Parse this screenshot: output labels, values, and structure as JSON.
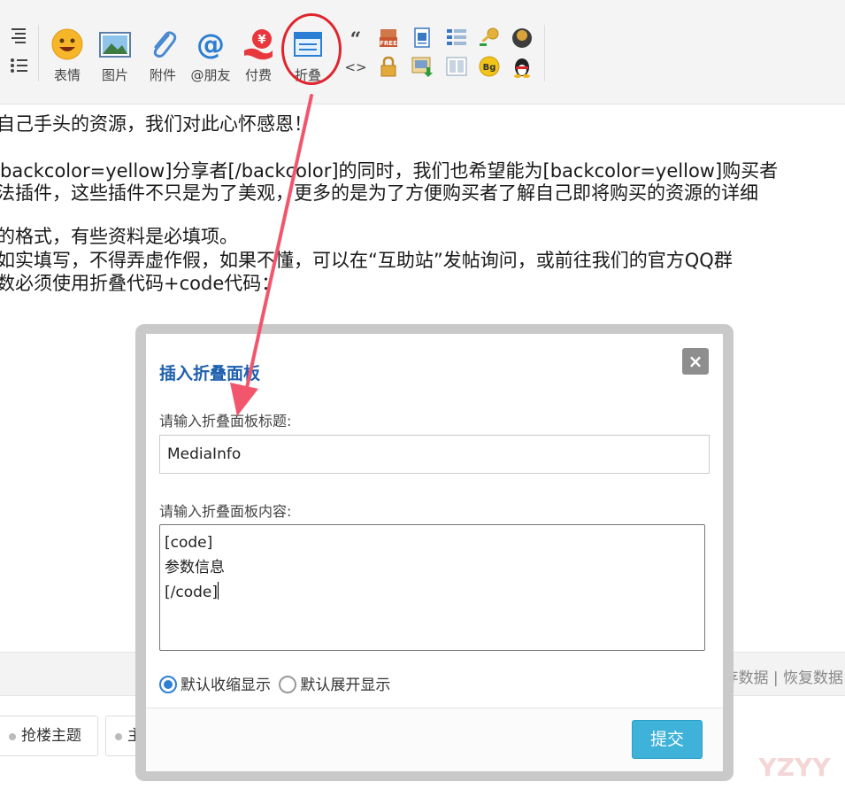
{
  "toolbar": {
    "tools": [
      {
        "label": "表情",
        "icon": "emoji-face-icon"
      },
      {
        "label": "图片",
        "icon": "image-icon"
      },
      {
        "label": "附件",
        "icon": "paperclip-icon"
      },
      {
        "label": "@朋友",
        "icon": "at-sign-icon"
      },
      {
        "label": "付费",
        "icon": "yen-pay-icon"
      },
      {
        "label": "折叠",
        "icon": "collapse-panel-icon"
      }
    ],
    "mini_icons": [
      "quote-icon",
      "code-icon",
      "free-tag-icon",
      "lock-icon",
      "word-doc-icon",
      "download-icon",
      "list-table-icon",
      "columns-icon",
      "key-icon",
      "bg-icon",
      "gold-ball-icon",
      "qq-penguin-icon"
    ],
    "quote_glyph": "“",
    "code_glyph": "<>",
    "free_text": "FREE",
    "bg_text": "Bg"
  },
  "editor": {
    "lines": [
      "自己手头的资源，我们对此心怀感恩！",
      "backcolor=yellow]分享者[/backcolor]的同时，我们也希望能为[backcolor=yellow]购买者",
      "法插件，这些插件不只是为了美观，更多的是为了方便购买者了解自己即将购买的资源的详细",
      "的格式，有些资料是必填项。",
      "如实填写，不得弄虚作假，如果不懂，可以在“互助站”发帖询问，或前往我们的官方QQ群",
      "数必须使用折叠代码+code代码："
    ],
    "footer": {
      "save_data": "存数据",
      "separator": "|",
      "restore_data": "恢复数据"
    }
  },
  "chips": [
    {
      "label": "抢楼主题"
    },
    {
      "label": "主"
    }
  ],
  "dialog": {
    "title": "插入折叠面板",
    "close_glyph": "×",
    "title_label": "请输入折叠面板标题:",
    "title_value": "MediaInfo",
    "content_label": "请输入折叠面板内容:",
    "content_lines": [
      "[code]",
      "参数信息",
      "[/code]"
    ],
    "radio_collapsed": "默认收缩显示",
    "radio_expanded": "默认展开显示",
    "selected_option": "默认收缩显示",
    "submit_label": "提交"
  },
  "watermark": {
    "text": "YZYY"
  },
  "colors": {
    "annotation_red": "#e0242e",
    "dialog_title": "#1d5fae",
    "submit_button": "#3fb2d9",
    "radio_selected": "#2f7fd6"
  }
}
